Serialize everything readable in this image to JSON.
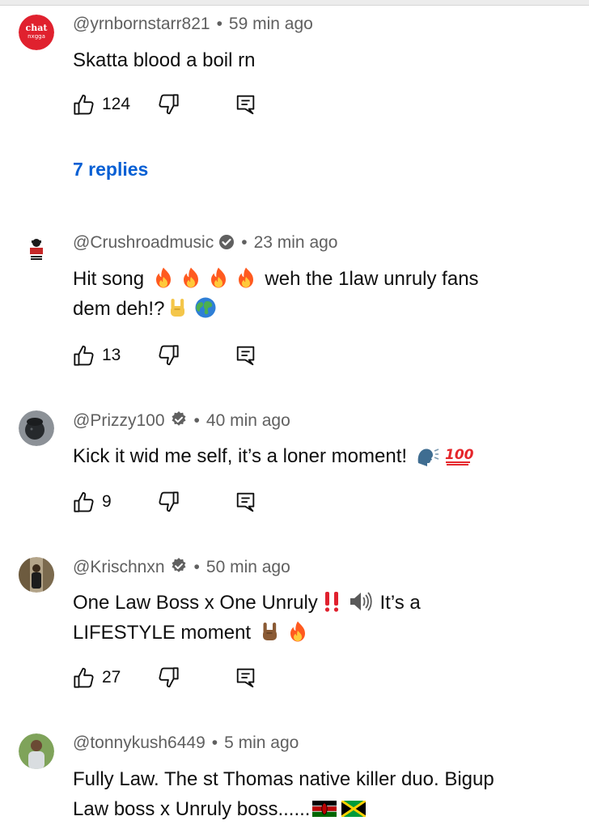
{
  "comments": [
    {
      "author": "@yrnbornstarr821",
      "time": "59 min ago",
      "verified": false,
      "text": "Skatta blood a boil rn",
      "likes": "124",
      "replies": "7 replies",
      "avatar_text": "chat",
      "avatar_subtext": "nxgga",
      "avatar_color": "#e0212e"
    },
    {
      "author": "@Crushroadmusic",
      "time": "23 min ago",
      "verified": true,
      "text_line1": "Hit song",
      "text_line1_tail": "weh the 1law unruly fans",
      "text_line2": "dem deh!?",
      "likes": "13"
    },
    {
      "author": "@Prizzy100",
      "time": "40 min ago",
      "verified": true,
      "text": "Kick it wid me self, it’s a loner moment!",
      "likes": "9"
    },
    {
      "author": "@Krischnxn",
      "time": "50 min ago",
      "verified": true,
      "text_line1": "One Law Boss x One Unruly",
      "text_line1_tail": "It’s a",
      "text_line2": "LIFESTYLE moment",
      "likes": "27"
    },
    {
      "author": "@tonnykush6449",
      "time": "5 min ago",
      "verified": false,
      "text_line1": "Fully Law. The st Thomas native killer duo. Bigup",
      "text_line2": "Law boss x Unruly boss......"
    }
  ],
  "separator": "•",
  "icons": {
    "like": "thumbs-up-icon",
    "dislike": "thumbs-down-icon",
    "reply": "reply-comment-icon",
    "verified": "verified-badge-icon"
  },
  "colors": {
    "meta": "#606060",
    "link": "#065fd4",
    "text": "#0f0f0f"
  }
}
